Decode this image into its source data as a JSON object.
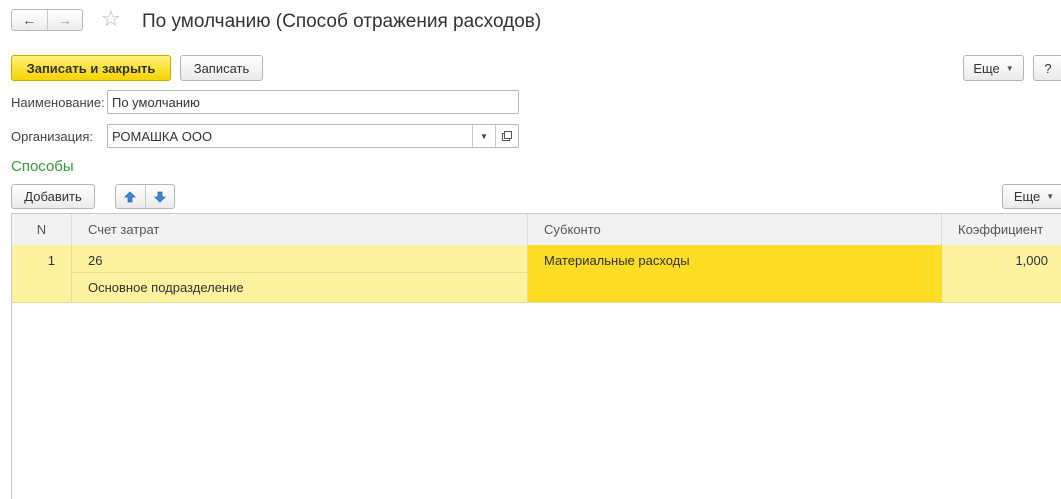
{
  "window": {
    "title": "По умолчанию (Способ отражения расходов)",
    "back_icon": "←",
    "forward_icon": "→",
    "favorite_icon": "☆"
  },
  "toolbar": {
    "save_close_label": "Записать и закрыть",
    "save_label": "Записать",
    "more_label": "Еще",
    "help_label": "?"
  },
  "form": {
    "name_label": "Наименование:",
    "name_value": "По умолчанию",
    "org_label": "Организация:",
    "org_value": "РОМАШКА ООО"
  },
  "section": {
    "title": "Способы",
    "add_label": "Добавить",
    "more_label": "Еще"
  },
  "table": {
    "columns": [
      "N",
      "Счет затрат",
      "Субконто",
      "Коэффициент"
    ],
    "rows": [
      {
        "n": "1",
        "account": "26",
        "account_sub": "Основное подразделение",
        "subconto": "Материальные расходы",
        "coefficient": "1,000"
      }
    ]
  },
  "colors": {
    "primary_button": "#f5d400",
    "section_title": "#3a9a3a",
    "row_highlight": "#fbf2a0",
    "cell_selected": "#fcdc24"
  }
}
